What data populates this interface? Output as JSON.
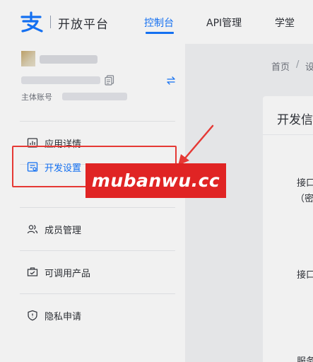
{
  "brand": {
    "name": "开放平台",
    "accent": "#1677ff"
  },
  "nav": {
    "tabs": [
      {
        "label": "控制台"
      },
      {
        "label": "API管理"
      },
      {
        "label": "学堂"
      }
    ]
  },
  "account": {
    "main_account_label": "主体账号"
  },
  "sidebar": {
    "items": [
      {
        "label": "应用详情",
        "icon": "app-detail-icon"
      },
      {
        "label": "开发设置",
        "icon": "dev-settings-icon"
      },
      {
        "label": "成员管理",
        "icon": "members-icon"
      },
      {
        "label": "可调用产品",
        "icon": "products-icon"
      },
      {
        "label": "隐私申请",
        "icon": "privacy-shield-icon"
      }
    ]
  },
  "breadcrumb": {
    "home": "首页",
    "separator": "/",
    "current": "设"
  },
  "card": {
    "title": "开发信",
    "field1_label": "接口",
    "field1_sub": "（密",
    "field2_label": "接口",
    "field3_label": "服务"
  },
  "annotation": {
    "watermark": "mubanwu.cc",
    "highlight_color": "#e53935"
  }
}
